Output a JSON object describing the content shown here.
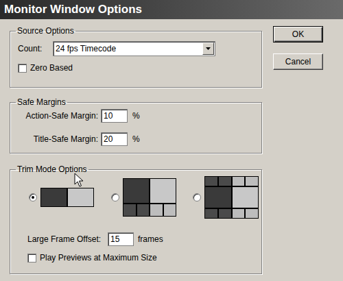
{
  "window": {
    "title": "Monitor Window Options"
  },
  "source_options": {
    "title": "Source Options",
    "count": {
      "label": "Count:",
      "value": "24 fps Timecode"
    },
    "zero_based": {
      "label": "Zero Based",
      "checked": false
    }
  },
  "safe_margins": {
    "title": "Safe Margins",
    "fields": [
      {
        "label": "Action-Safe Margin:",
        "value": "10",
        "unit": "%"
      },
      {
        "label": "Title-Safe Margin:",
        "value": "20",
        "unit": "%"
      }
    ]
  },
  "trim_mode_options": {
    "title": "Trim Mode Options",
    "layouts": [
      {
        "kind": "two",
        "selected": true
      },
      {
        "kind": "six",
        "selected": false
      },
      {
        "kind": "ten",
        "selected": false
      }
    ],
    "large_frame_offset": {
      "label": "Large Frame Offset:",
      "value": "15",
      "unit": "frames"
    },
    "play_previews": {
      "label": "Play Previews at Maximum Size",
      "checked": false
    }
  },
  "buttons": [
    {
      "label": "OK",
      "default": true
    },
    {
      "label": "Cancel",
      "default": false
    }
  ]
}
